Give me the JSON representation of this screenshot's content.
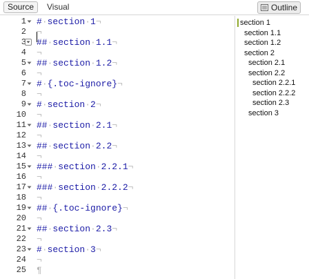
{
  "toolbar": {
    "source_label": "Source",
    "visual_label": "Visual",
    "outline_label": "Outline",
    "outline_icon": "outline-icon"
  },
  "editor": {
    "lines": [
      {
        "n": "1",
        "fold": true,
        "segments": [
          {
            "t": "#",
            "c": "tok"
          },
          {
            "t": "·",
            "c": "ws"
          },
          {
            "t": "section",
            "c": "tok"
          },
          {
            "t": "·",
            "c": "ws"
          },
          {
            "t": "1",
            "c": "tok"
          },
          {
            "t": "¬",
            "c": "eol"
          }
        ]
      },
      {
        "n": "2",
        "fold": false,
        "segments": [
          {
            "t": "¬",
            "c": "eol"
          }
        ]
      },
      {
        "n": "3",
        "fold": "box",
        "segments": [
          {
            "t": "##",
            "c": "tok"
          },
          {
            "t": "·",
            "c": "ws"
          },
          {
            "t": "section",
            "c": "tok"
          },
          {
            "t": "·",
            "c": "ws"
          },
          {
            "t": "1.1",
            "c": "tok"
          },
          {
            "t": "¬",
            "c": "eol"
          }
        ]
      },
      {
        "n": "4",
        "fold": false,
        "segments": [
          {
            "t": "¬",
            "c": "eol"
          }
        ]
      },
      {
        "n": "5",
        "fold": true,
        "segments": [
          {
            "t": "##",
            "c": "tok"
          },
          {
            "t": "·",
            "c": "ws"
          },
          {
            "t": "section",
            "c": "tok"
          },
          {
            "t": "·",
            "c": "ws"
          },
          {
            "t": "1.2",
            "c": "tok"
          },
          {
            "t": "¬",
            "c": "eol"
          }
        ]
      },
      {
        "n": "6",
        "fold": false,
        "segments": [
          {
            "t": "¬",
            "c": "eol"
          }
        ]
      },
      {
        "n": "7",
        "fold": true,
        "segments": [
          {
            "t": "#",
            "c": "tok"
          },
          {
            "t": "·",
            "c": "ws"
          },
          {
            "t": "{.toc-ignore}",
            "c": "tok"
          },
          {
            "t": "¬",
            "c": "eol"
          }
        ]
      },
      {
        "n": "8",
        "fold": false,
        "segments": [
          {
            "t": "¬",
            "c": "eol"
          }
        ]
      },
      {
        "n": "9",
        "fold": true,
        "segments": [
          {
            "t": "#",
            "c": "tok"
          },
          {
            "t": "·",
            "c": "ws"
          },
          {
            "t": "section",
            "c": "tok"
          },
          {
            "t": "·",
            "c": "ws"
          },
          {
            "t": "2",
            "c": "tok"
          },
          {
            "t": "¬",
            "c": "eol"
          }
        ]
      },
      {
        "n": "10",
        "fold": false,
        "segments": [
          {
            "t": "¬",
            "c": "eol"
          }
        ]
      },
      {
        "n": "11",
        "fold": true,
        "segments": [
          {
            "t": "##",
            "c": "tok"
          },
          {
            "t": "·",
            "c": "ws"
          },
          {
            "t": "section",
            "c": "tok"
          },
          {
            "t": "·",
            "c": "ws"
          },
          {
            "t": "2.1",
            "c": "tok"
          },
          {
            "t": "¬",
            "c": "eol"
          }
        ]
      },
      {
        "n": "12",
        "fold": false,
        "segments": [
          {
            "t": "¬",
            "c": "eol"
          }
        ]
      },
      {
        "n": "13",
        "fold": true,
        "segments": [
          {
            "t": "##",
            "c": "tok"
          },
          {
            "t": "·",
            "c": "ws"
          },
          {
            "t": "section",
            "c": "tok"
          },
          {
            "t": "·",
            "c": "ws"
          },
          {
            "t": "2.2",
            "c": "tok"
          },
          {
            "t": "¬",
            "c": "eol"
          }
        ]
      },
      {
        "n": "14",
        "fold": false,
        "segments": [
          {
            "t": "¬",
            "c": "eol"
          }
        ]
      },
      {
        "n": "15",
        "fold": true,
        "segments": [
          {
            "t": "###",
            "c": "tok"
          },
          {
            "t": "·",
            "c": "ws"
          },
          {
            "t": "section",
            "c": "tok"
          },
          {
            "t": "·",
            "c": "ws"
          },
          {
            "t": "2.2.1",
            "c": "tok"
          },
          {
            "t": "¬",
            "c": "eol"
          }
        ]
      },
      {
        "n": "16",
        "fold": false,
        "segments": [
          {
            "t": "¬",
            "c": "eol"
          }
        ]
      },
      {
        "n": "17",
        "fold": true,
        "segments": [
          {
            "t": "###",
            "c": "tok"
          },
          {
            "t": "·",
            "c": "ws"
          },
          {
            "t": "section",
            "c": "tok"
          },
          {
            "t": "·",
            "c": "ws"
          },
          {
            "t": "2.2.2",
            "c": "tok"
          },
          {
            "t": "¬",
            "c": "eol"
          }
        ]
      },
      {
        "n": "18",
        "fold": false,
        "segments": [
          {
            "t": "¬",
            "c": "eol"
          }
        ]
      },
      {
        "n": "19",
        "fold": true,
        "segments": [
          {
            "t": "##",
            "c": "tok"
          },
          {
            "t": "·",
            "c": "ws"
          },
          {
            "t": "{.toc-ignore}",
            "c": "tok"
          },
          {
            "t": "¬",
            "c": "eol"
          }
        ]
      },
      {
        "n": "20",
        "fold": false,
        "segments": [
          {
            "t": "¬",
            "c": "eol"
          }
        ]
      },
      {
        "n": "21",
        "fold": true,
        "segments": [
          {
            "t": "##",
            "c": "tok"
          },
          {
            "t": "·",
            "c": "ws"
          },
          {
            "t": "section",
            "c": "tok"
          },
          {
            "t": "·",
            "c": "ws"
          },
          {
            "t": "2.3",
            "c": "tok"
          },
          {
            "t": "¬",
            "c": "eol"
          }
        ]
      },
      {
        "n": "22",
        "fold": false,
        "segments": [
          {
            "t": "¬",
            "c": "eol"
          }
        ]
      },
      {
        "n": "23",
        "fold": true,
        "segments": [
          {
            "t": "#",
            "c": "tok"
          },
          {
            "t": "·",
            "c": "ws"
          },
          {
            "t": "section",
            "c": "tok"
          },
          {
            "t": "·",
            "c": "ws"
          },
          {
            "t": "3",
            "c": "tok"
          },
          {
            "t": "¬",
            "c": "eol"
          }
        ]
      },
      {
        "n": "24",
        "fold": false,
        "segments": [
          {
            "t": "¬",
            "c": "eol"
          }
        ]
      },
      {
        "n": "25",
        "fold": false,
        "segments": [
          {
            "t": "¶",
            "c": "eol"
          }
        ]
      }
    ]
  },
  "outline": {
    "items": [
      {
        "label": "section 1",
        "level": 1,
        "active": true
      },
      {
        "label": "section 1.1",
        "level": 2
      },
      {
        "label": "section 1.2",
        "level": 2
      },
      {
        "label": "section 2",
        "level": 2
      },
      {
        "label": "section 2.1",
        "level": 3
      },
      {
        "label": "section 2.2",
        "level": 3
      },
      {
        "label": "section 2.2.1",
        "level": 4
      },
      {
        "label": "section 2.2.2",
        "level": 4
      },
      {
        "label": "section 2.3",
        "level": 4
      },
      {
        "label": "section 3",
        "level": 3
      }
    ]
  },
  "colors": {
    "heading_text": "#1a1aa6",
    "whitespace_marker": "#b8b8b8",
    "active_outline_bar": "#8ea82a"
  }
}
